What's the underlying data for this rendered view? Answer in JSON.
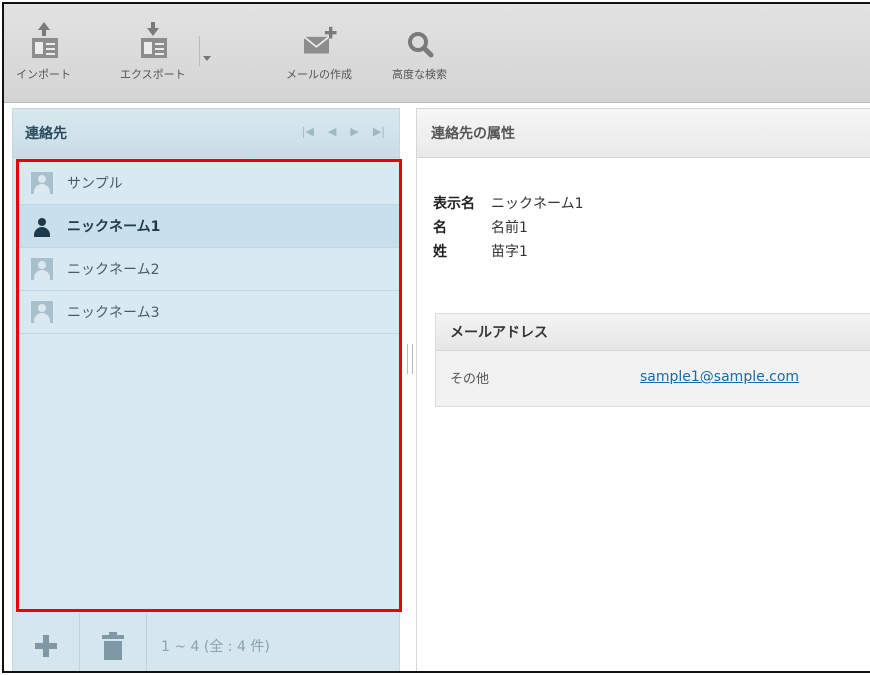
{
  "toolbar": {
    "import_label": "インポート",
    "export_label": "エクスポート",
    "compose_label": "メールの作成",
    "search_label": "高度な検索"
  },
  "left_panel": {
    "title": "連絡先",
    "pager": [
      "|◀",
      "◀",
      "▶",
      "▶|"
    ],
    "contacts": [
      {
        "name": "サンプル",
        "selected": false
      },
      {
        "name": "ニックネーム1",
        "selected": true
      },
      {
        "name": "ニックネーム2",
        "selected": false
      },
      {
        "name": "ニックネーム3",
        "selected": false
      }
    ],
    "count_text": "1 ~ 4 (全 : 4 件)"
  },
  "right_panel": {
    "title": "連絡先の属性",
    "attributes": [
      {
        "key": "表示名",
        "value": "ニックネーム1"
      },
      {
        "key": "名",
        "value": "名前1"
      },
      {
        "key": "姓",
        "value": "苗字1"
      }
    ],
    "email_section": {
      "title": "メールアドレス",
      "label": "その他",
      "address": "sample1@sample.com"
    }
  },
  "colors": {
    "highlight_border": "#ee0000",
    "left_panel_bg": "#d6e6ee",
    "link": "#1a6aa8"
  }
}
